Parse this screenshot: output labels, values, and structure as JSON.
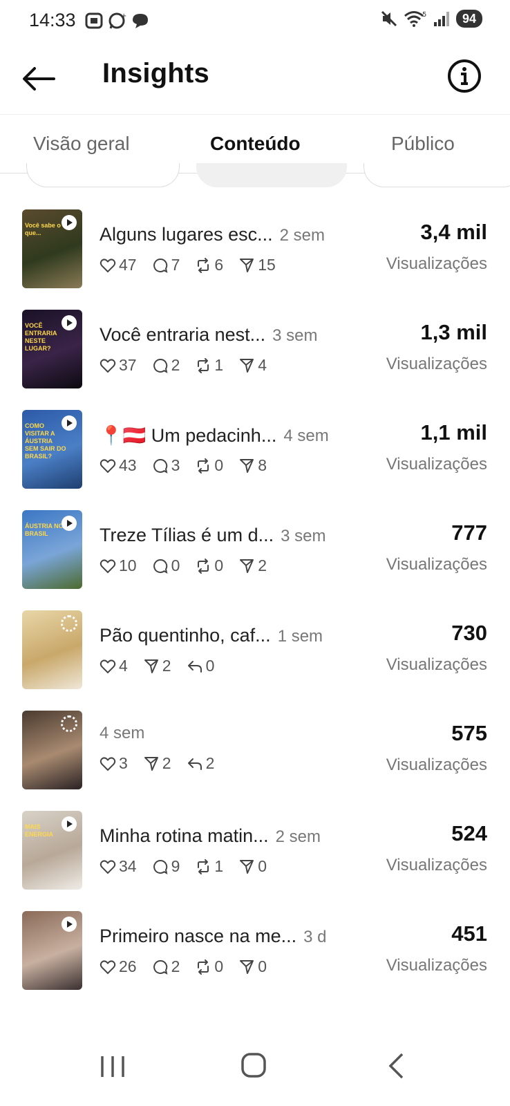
{
  "status_bar": {
    "time": "14:33",
    "battery": "94"
  },
  "header": {
    "title": "Insights"
  },
  "tabs": [
    {
      "label": "Visão geral",
      "active": false
    },
    {
      "label": "Conteúdo",
      "active": true
    },
    {
      "label": "Público",
      "active": false
    }
  ],
  "views_label": "Visualizações",
  "posts": [
    {
      "caption": "Alguns lugares esc...",
      "age": "2 sem",
      "views": "3,4 mil",
      "kind": "video",
      "stats": [
        {
          "icon": "heart-icon",
          "value": "47"
        },
        {
          "icon": "comment-icon",
          "value": "7"
        },
        {
          "icon": "repost-icon",
          "value": "6"
        },
        {
          "icon": "share-icon",
          "value": "15"
        }
      ],
      "thumb_colors": [
        "#5b4a2e",
        "#2f3a1e",
        "#8a7a55"
      ],
      "thumb_text": "Você sabe o que..."
    },
    {
      "caption": "Você entraria nest...",
      "age": "3 sem",
      "views": "1,3 mil",
      "kind": "video",
      "stats": [
        {
          "icon": "heart-icon",
          "value": "37"
        },
        {
          "icon": "comment-icon",
          "value": "2"
        },
        {
          "icon": "repost-icon",
          "value": "1"
        },
        {
          "icon": "share-icon",
          "value": "4"
        }
      ],
      "thumb_colors": [
        "#1a1226",
        "#3a2448",
        "#0c0a10"
      ],
      "thumb_text": "VOCÊ ENTRARIA NESTE LUGAR?"
    },
    {
      "caption": "📍🇦🇹 Um pedacinh...",
      "age": "4 sem",
      "views": "1,1 mil",
      "kind": "video",
      "stats": [
        {
          "icon": "heart-icon",
          "value": "43"
        },
        {
          "icon": "comment-icon",
          "value": "3"
        },
        {
          "icon": "repost-icon",
          "value": "0"
        },
        {
          "icon": "share-icon",
          "value": "8"
        }
      ],
      "thumb_colors": [
        "#2d5aa8",
        "#4a7fc6",
        "#1f3f70"
      ],
      "thumb_text": "COMO VISITAR A ÁUSTRIA SEM SAIR DO BRASIL?"
    },
    {
      "caption": "Treze Tílias é um d...",
      "age": "3 sem",
      "views": "777",
      "kind": "video",
      "stats": [
        {
          "icon": "heart-icon",
          "value": "10"
        },
        {
          "icon": "comment-icon",
          "value": "0"
        },
        {
          "icon": "repost-icon",
          "value": "0"
        },
        {
          "icon": "share-icon",
          "value": "2"
        }
      ],
      "thumb_colors": [
        "#3b77c4",
        "#7aa5d8",
        "#4c6a2e"
      ],
      "thumb_text": "ÁUSTRIA NO BRASIL"
    },
    {
      "caption": "Pão quentinho, caf...",
      "age": "1 sem",
      "views": "730",
      "kind": "story",
      "stats": [
        {
          "icon": "heart-icon",
          "value": "4"
        },
        {
          "icon": "share-icon",
          "value": "2"
        },
        {
          "icon": "reply-icon",
          "value": "0"
        }
      ],
      "thumb_colors": [
        "#e8d6a8",
        "#c9a86a",
        "#efe7d8"
      ],
      "thumb_text": ""
    },
    {
      "caption": "",
      "age": "4 sem",
      "views": "575",
      "kind": "story",
      "stats": [
        {
          "icon": "heart-icon",
          "value": "3"
        },
        {
          "icon": "share-icon",
          "value": "2"
        },
        {
          "icon": "reply-icon",
          "value": "2"
        }
      ],
      "thumb_colors": [
        "#4a3a30",
        "#a88a70",
        "#2a2224"
      ],
      "thumb_text": ""
    },
    {
      "caption": "Minha rotina matin...",
      "age": "2 sem",
      "views": "524",
      "kind": "video",
      "stats": [
        {
          "icon": "heart-icon",
          "value": "34"
        },
        {
          "icon": "comment-icon",
          "value": "9"
        },
        {
          "icon": "repost-icon",
          "value": "1"
        },
        {
          "icon": "share-icon",
          "value": "0"
        }
      ],
      "thumb_colors": [
        "#d8d2c8",
        "#b8a898",
        "#efece6"
      ],
      "thumb_text": "MAIS ENERGIA"
    },
    {
      "caption": "Primeiro nasce na me...",
      "age": "3 d",
      "views": "451",
      "kind": "video",
      "stats": [
        {
          "icon": "heart-icon",
          "value": "26"
        },
        {
          "icon": "comment-icon",
          "value": "2"
        },
        {
          "icon": "repost-icon",
          "value": "0"
        },
        {
          "icon": "share-icon",
          "value": "0"
        }
      ],
      "thumb_colors": [
        "#8a6a58",
        "#c8b0a0",
        "#3a3030"
      ],
      "thumb_text": ""
    }
  ]
}
